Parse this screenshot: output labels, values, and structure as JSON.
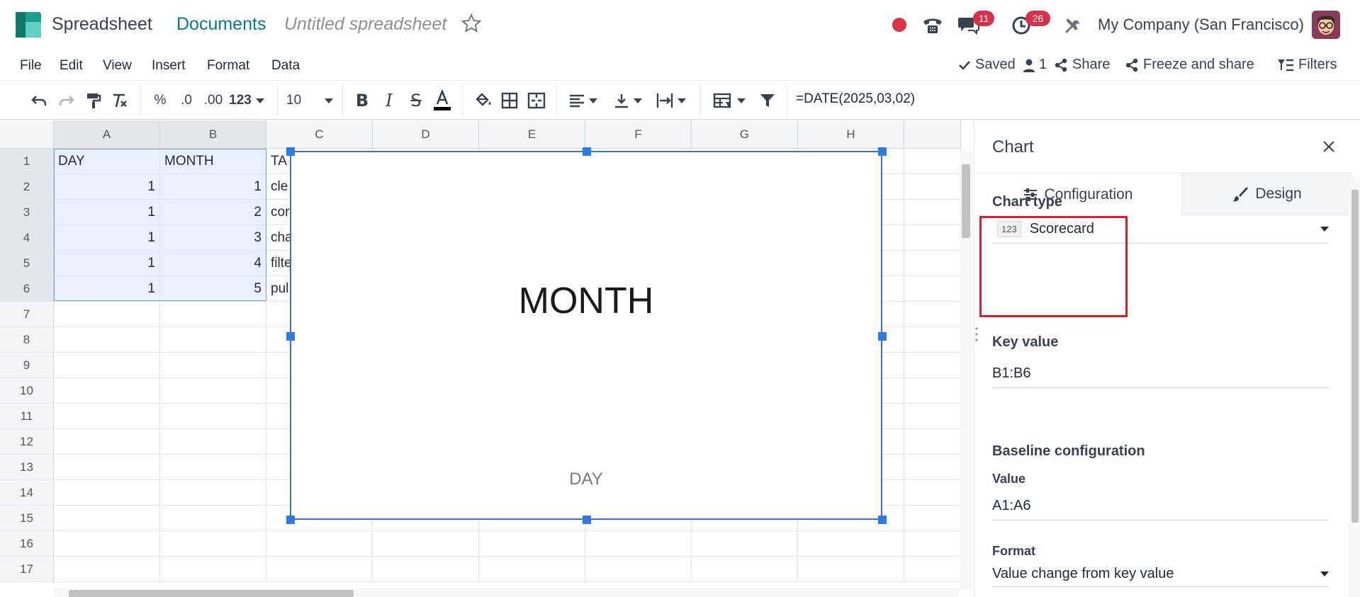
{
  "header": {
    "app_name": "Spreadsheet",
    "breadcrumb_parent": "Documents",
    "document_title": "Untitled spreadsheet",
    "messages_count": "11",
    "activities_count": "26",
    "company": "My Company (San Francisco)"
  },
  "menu": [
    "File",
    "Edit",
    "View",
    "Insert",
    "Format",
    "Data"
  ],
  "actions": {
    "saved": "Saved",
    "users_count": "1",
    "share": "Share",
    "freeze_share": "Freeze and share",
    "filters": "Filters"
  },
  "toolbar": {
    "percent": "%",
    "dec_decrease": ".0",
    "dec_increase": ".00",
    "number_format": "123",
    "font_size": "10",
    "formula": "=DATE(2025,03,02)"
  },
  "grid": {
    "columns": [
      "A",
      "B",
      "C",
      "D",
      "E",
      "F",
      "G",
      "H"
    ],
    "rows": [
      "1",
      "2",
      "3",
      "4",
      "5",
      "6",
      "7",
      "8",
      "9",
      "10",
      "11",
      "12",
      "13",
      "14",
      "15",
      "16",
      "17"
    ],
    "colA": [
      "DAY",
      "1",
      "1",
      "1",
      "1",
      "1"
    ],
    "colB": [
      "MONTH",
      "1",
      "2",
      "3",
      "4",
      "5"
    ],
    "colC": [
      "TA",
      "cle",
      "cor",
      "cha",
      "filte",
      "pul"
    ]
  },
  "chart": {
    "key_text": "MONTH",
    "baseline_text": "DAY"
  },
  "panel": {
    "title": "Chart",
    "tab_config": "Configuration",
    "tab_design": "Design",
    "chart_type_label": "Chart type",
    "chart_type_tag": "123",
    "chart_type_value": "Scorecard",
    "key_value_label": "Key value",
    "key_value": "B1:B6",
    "baseline_label": "Baseline configuration",
    "value_label": "Value",
    "value": "A1:A6",
    "format_label": "Format",
    "format_value": "Value change from key value"
  },
  "colors": {
    "accent": "#017e84",
    "selection": "#e8f0fe",
    "chart_border": "#3a73c6",
    "highlight": "#d0202d"
  }
}
